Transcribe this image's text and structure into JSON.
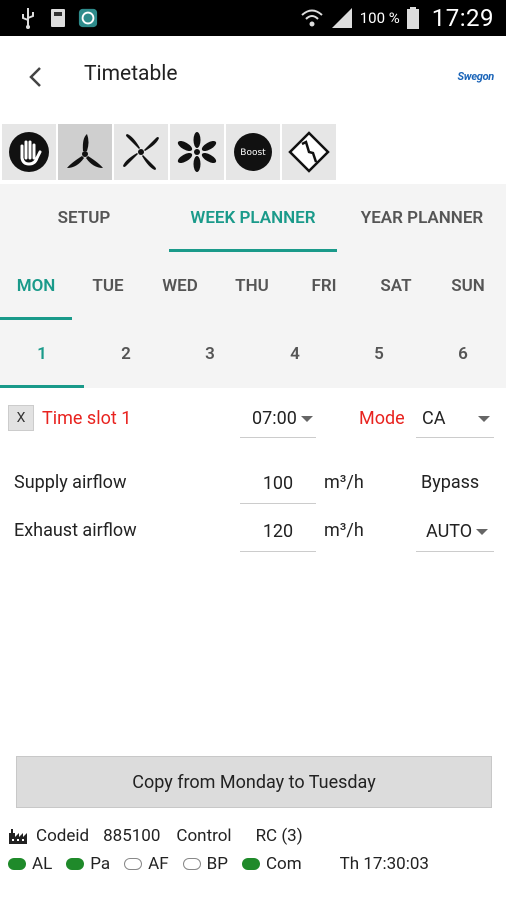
{
  "status_bar": {
    "battery_percent": "100 %",
    "time": "17:29"
  },
  "app_bar": {
    "title": "Timetable",
    "logo": "Swegon"
  },
  "mode_buttons": [
    {
      "name": "manual-hand-icon"
    },
    {
      "name": "fan-low-icon"
    },
    {
      "name": "fan-medium-icon"
    },
    {
      "name": "fan-high-icon"
    },
    {
      "name": "boost-icon",
      "label": "Boost"
    },
    {
      "name": "auto-curve-icon"
    }
  ],
  "tabs": [
    {
      "label": "SETUP",
      "active": false
    },
    {
      "label": "WEEK PLANNER",
      "active": true
    },
    {
      "label": "YEAR PLANNER",
      "active": false
    }
  ],
  "days": [
    {
      "label": "MON",
      "active": true
    },
    {
      "label": "TUE",
      "active": false
    },
    {
      "label": "WED",
      "active": false
    },
    {
      "label": "THU",
      "active": false
    },
    {
      "label": "FRI",
      "active": false
    },
    {
      "label": "SAT",
      "active": false
    },
    {
      "label": "SUN",
      "active": false
    }
  ],
  "slots": [
    {
      "label": "1",
      "active": true
    },
    {
      "label": "2",
      "active": false
    },
    {
      "label": "3",
      "active": false
    },
    {
      "label": "4",
      "active": false
    },
    {
      "label": "5",
      "active": false
    },
    {
      "label": "6",
      "active": false
    }
  ],
  "timeslot": {
    "remove_label": "X",
    "title": "Time slot 1",
    "time": "07:00",
    "mode_label": "Mode",
    "mode_value": "CA"
  },
  "supply": {
    "label": "Supply airflow",
    "value": "100",
    "unit": "m³/h",
    "extra": "Bypass"
  },
  "exhaust": {
    "label": "Exhaust airflow",
    "value": "120",
    "unit": "m³/h",
    "extra": "AUTO"
  },
  "copy_button": "Copy from Monday to Tuesday",
  "footer": {
    "codeid_label": "Codeid",
    "codeid_value": "885100",
    "control_label": "Control",
    "control_value": "RC (3)",
    "indicators": [
      {
        "label": "AL",
        "on": true
      },
      {
        "label": "Pa",
        "on": true
      },
      {
        "label": "AF",
        "on": false
      },
      {
        "label": "BP",
        "on": false
      },
      {
        "label": "Com",
        "on": true
      }
    ],
    "datetime": "Th 17:30:03"
  },
  "colors": {
    "accent": "#1a9a8a",
    "alert_red": "#e8231f",
    "led_green": "#1f8a2a"
  }
}
